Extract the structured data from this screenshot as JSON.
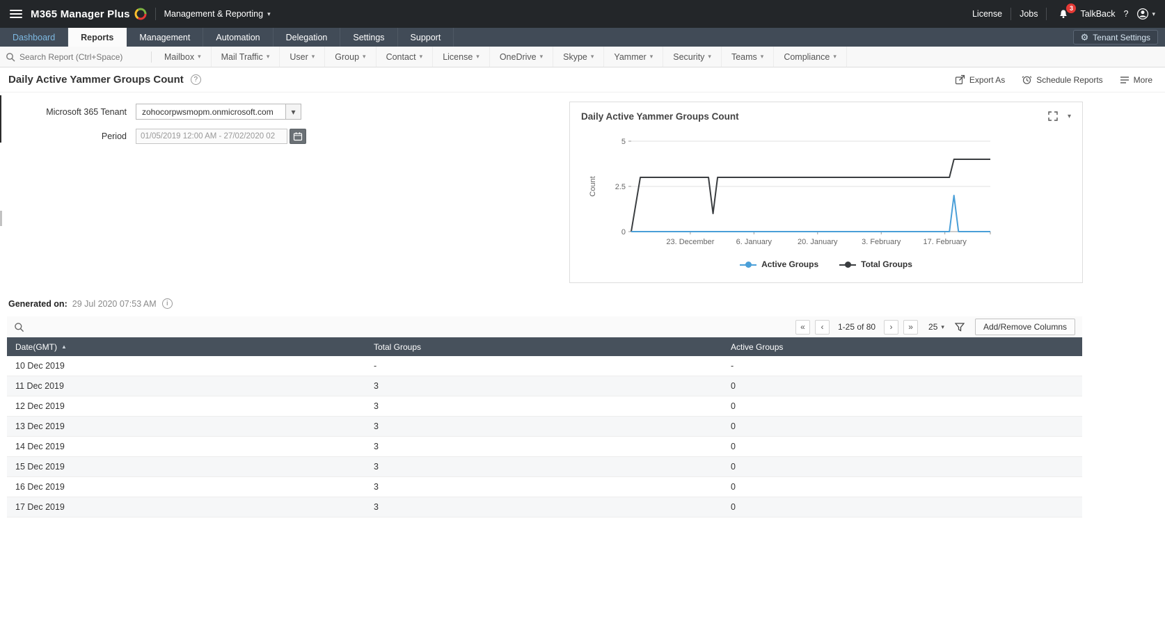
{
  "colors": {
    "accent_blue": "#4a9fd8",
    "series_dark": "#3a3d40",
    "topbar_bg": "#232629",
    "navbar_bg": "#414b57",
    "table_header_bg": "#47515c",
    "badge_red": "#e53935"
  },
  "icons": {
    "chevron_down": "▾",
    "sort_asc": "▲",
    "search": "magnifier",
    "gear": "⚙",
    "bell": "notification-bell",
    "user": "person-avatar",
    "calendar": "calendar",
    "filter": "funnel",
    "help": "?",
    "info": "i"
  },
  "header": {
    "app_name": "M365 Manager Plus",
    "context_label": "Management & Reporting",
    "license_label": "License",
    "jobs_label": "Jobs",
    "notification_count": "3",
    "talkback_label": "TalkBack",
    "help_label": "?"
  },
  "nav": {
    "tabs": [
      "Dashboard",
      "Reports",
      "Management",
      "Automation",
      "Delegation",
      "Settings",
      "Support"
    ],
    "active_tab": "Reports",
    "tenant_settings_label": "Tenant Settings"
  },
  "report_nav": {
    "search_placeholder": "Search Report (Ctrl+Space)",
    "menus": [
      "Mailbox",
      "Mail Traffic",
      "User",
      "Group",
      "Contact",
      "License",
      "OneDrive",
      "Skype",
      "Yammer",
      "Security",
      "Teams",
      "Compliance"
    ]
  },
  "page": {
    "title": "Daily Active Yammer Groups Count",
    "actions": {
      "export": "Export As",
      "schedule": "Schedule Reports",
      "more": "More"
    }
  },
  "form": {
    "tenant_label": "Microsoft 365 Tenant",
    "tenant_value": "zohocorpwsmopm.onmicrosoft.com",
    "period_label": "Period",
    "period_value": "01/05/2019 12:00 AM - 27/02/2020 02"
  },
  "chart_panel": {
    "title": "Daily Active Yammer Groups Count"
  },
  "chart_data": {
    "type": "line",
    "title": "Daily Active Yammer Groups Count",
    "ylabel": "Count",
    "ylim": [
      0,
      5
    ],
    "yticks": [
      0,
      2.5,
      5
    ],
    "xlim": [
      0,
      79
    ],
    "x_unit": "days since 10 Dec 2019",
    "xticks": [
      {
        "x": 13,
        "label": "23. December"
      },
      {
        "x": 27,
        "label": "6. January"
      },
      {
        "x": 41,
        "label": "20. January"
      },
      {
        "x": 55,
        "label": "3. February"
      },
      {
        "x": 69,
        "label": "17. February"
      }
    ],
    "legend_position": "bottom",
    "grid": true,
    "series": [
      {
        "name": "Active Groups",
        "color": "#4a9fd8",
        "points": [
          [
            0,
            0
          ],
          [
            70,
            0
          ],
          [
            71,
            2
          ],
          [
            72,
            0
          ],
          [
            79,
            0
          ]
        ]
      },
      {
        "name": "Total Groups",
        "color": "#3a3d40",
        "points": [
          [
            0,
            0
          ],
          [
            2,
            3
          ],
          [
            17,
            3
          ],
          [
            18,
            1
          ],
          [
            19,
            3
          ],
          [
            70,
            3
          ],
          [
            71,
            4
          ],
          [
            79,
            4
          ]
        ]
      }
    ]
  },
  "generated": {
    "label": "Generated on:",
    "value": "29 Jul 2020 07:53 AM"
  },
  "toolbar": {
    "first": "«",
    "prev": "‹",
    "next": "›",
    "last": "»",
    "range": "1-25 of 80",
    "page_size": "25",
    "add_remove_columns": "Add/Remove Columns"
  },
  "table": {
    "headers": [
      "Date(GMT)",
      "Total Groups",
      "Active Groups"
    ],
    "sort_column": "Date(GMT)",
    "sort_dir": "asc",
    "rows": [
      [
        "10 Dec 2019",
        "-",
        "-"
      ],
      [
        "11 Dec 2019",
        "3",
        "0"
      ],
      [
        "12 Dec 2019",
        "3",
        "0"
      ],
      [
        "13 Dec 2019",
        "3",
        "0"
      ],
      [
        "14 Dec 2019",
        "3",
        "0"
      ],
      [
        "15 Dec 2019",
        "3",
        "0"
      ],
      [
        "16 Dec 2019",
        "3",
        "0"
      ],
      [
        "17 Dec 2019",
        "3",
        "0"
      ]
    ]
  }
}
